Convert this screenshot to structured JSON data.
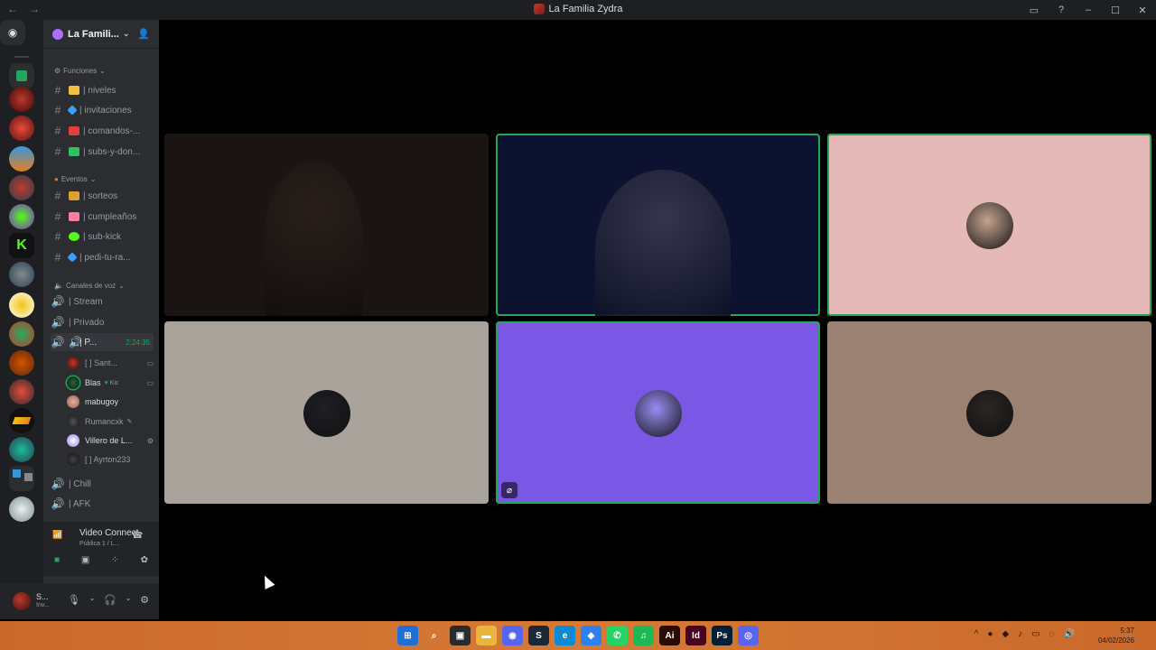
{
  "window": {
    "title": "La Familia Zydra",
    "nav": [
      "←",
      "→"
    ],
    "controls": [
      "▭",
      "?",
      "–",
      "☐",
      "✕"
    ]
  },
  "server": {
    "name": "La Famili...",
    "categories": [
      {
        "label": "Funciones",
        "icon": "gear-icon"
      },
      {
        "label": "Eventos",
        "icon": "calendar-icon"
      },
      {
        "label": "Canales de voz",
        "icon": "speaker-icon"
      }
    ],
    "text_channels": [
      {
        "label": "| niveles",
        "emoji_color": "#f0c040"
      },
      {
        "label": "| invitaciones",
        "emoji_color": "#3aa0ff"
      },
      {
        "label": "| comandos-...",
        "emoji_color": "#e04040"
      },
      {
        "label": "| subs-y-don...",
        "emoji_color": "#30c060"
      },
      {
        "label": "| sorteos",
        "emoji_color": "#e0a030"
      },
      {
        "label": "| cumpleaños",
        "emoji_color": "#ff7fa0"
      },
      {
        "label": "| sub-kick",
        "emoji_color": "#53fc18"
      },
      {
        "label": "| pedi-tu-ra...",
        "emoji_color": "#3aa0ff"
      }
    ],
    "voice_channels": [
      {
        "label": "| Stream"
      },
      {
        "label": "| Privado"
      },
      {
        "label": "| P...",
        "timer": "2:24:35",
        "active": true
      },
      {
        "label": "| Chill"
      },
      {
        "label": "| AFK"
      }
    ],
    "voice_users": [
      {
        "name": "[ ] Sant...",
        "color": "#7a2a2a",
        "cam": "▭"
      },
      {
        "name": "Blas",
        "extra": "Kic",
        "color": "#2c5e3c",
        "cam": "▭",
        "speaking": true
      },
      {
        "name": "mabugoy",
        "color": "#c98a7a",
        "cam": ""
      },
      {
        "name": "Rumancxk",
        "color": "#555555",
        "cam": ""
      },
      {
        "name": "Villero de L...",
        "color": "#8a7df0",
        "cam": "⚙"
      },
      {
        "name": "[ ] Ayrton233",
        "color": "#444444",
        "cam": ""
      }
    ]
  },
  "voice_panel": {
    "status": "Video Connect",
    "channel": "Pública 1 / L...",
    "row_icons": [
      "camera-icon",
      "screenshare-icon",
      "activities-icon",
      "soundboard-icon"
    ]
  },
  "user_panel": {
    "name": "S...",
    "status": "Inv..."
  },
  "tiles": [
    {
      "kind": "video",
      "bg": "#1a1513",
      "speaking": false
    },
    {
      "kind": "video",
      "bg": "#0d1230",
      "speaking": true
    },
    {
      "kind": "avatar",
      "bg": "#e6b9b9",
      "speaking": true,
      "avatar": "#c6a38f"
    },
    {
      "kind": "avatar",
      "bg": "#a9a39b",
      "speaking": false,
      "avatar": "#1f1f24"
    },
    {
      "kind": "avatar",
      "bg": "#7b57e6",
      "speaking": true,
      "avatar": "#9a8cf5",
      "badge": "⌀"
    },
    {
      "kind": "avatar",
      "bg": "#9a8172",
      "speaking": false,
      "avatar": "#2a2624"
    }
  ],
  "taskbar": {
    "apps": [
      {
        "label": "⊞",
        "color": "#1f6fd6"
      },
      {
        "label": "⌕",
        "color": "transparent"
      },
      {
        "label": "▣",
        "color": "#2b2b2b"
      },
      {
        "label": "▬",
        "color": "#e9b53c"
      },
      {
        "label": "◉",
        "color": "#5865f2"
      },
      {
        "label": "S",
        "color": "#1b2838"
      },
      {
        "label": "e",
        "color": "#0c8ad6"
      },
      {
        "label": "◆",
        "color": "#2f80ed"
      },
      {
        "label": "✆",
        "color": "#25d366"
      },
      {
        "label": "♫",
        "color": "#1db954"
      },
      {
        "label": "Ai",
        "color": "#2d0a00"
      },
      {
        "label": "Id",
        "color": "#49021f"
      },
      {
        "label": "Ps",
        "color": "#001e36"
      },
      {
        "label": "◎",
        "color": "#5865f2"
      }
    ],
    "tray": [
      "^",
      "●",
      "◆",
      "♪",
      "▭",
      "◌",
      "🔊"
    ],
    "time": "5:37",
    "date": "04/02/2026"
  }
}
